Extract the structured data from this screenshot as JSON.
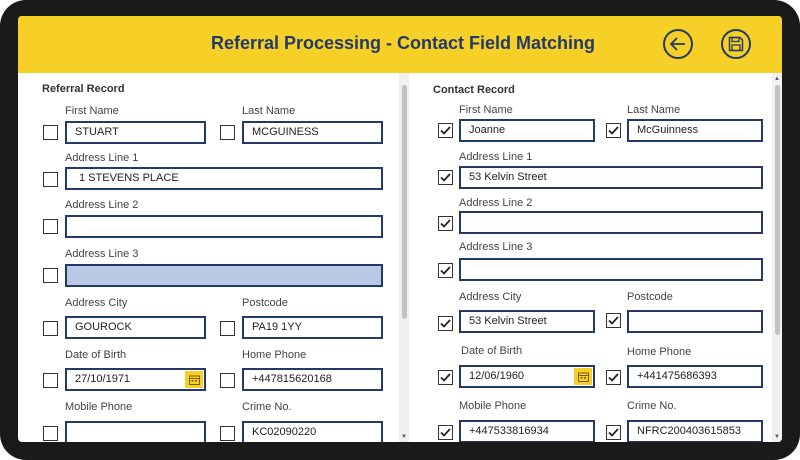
{
  "header": {
    "title": "Referral Processing - Contact Field Matching",
    "back_icon": "back-arrow-icon",
    "save_icon": "save-disk-icon",
    "accent": "#f6d027",
    "text_color": "#243a66"
  },
  "referral": {
    "title": "Referral Record",
    "first_name_label": "First Name",
    "first_name": "STUART",
    "last_name_label": "Last Name",
    "last_name": "MCGUINESS",
    "address1_label": "Address Line 1",
    "address1": "1 STEVENS PLACE",
    "address2_label": "Address Line 2",
    "address2": "",
    "address3_label": "Address Line 3",
    "address3": "",
    "city_label": "Address City",
    "city": "GOUROCK",
    "postcode_label": "Postcode",
    "postcode": "PA19 1YY",
    "dob_label": "Date of Birth",
    "dob": "27/10/1971",
    "home_phone_label": "Home Phone",
    "home_phone": "+447815620168",
    "mobile_label": "Mobile Phone",
    "mobile": "",
    "crime_label": "Crime No.",
    "crime": "KC02090220"
  },
  "contact": {
    "title": "Contact Record",
    "first_name_label": "First Name",
    "first_name": "Joanne",
    "last_name_label": "Last Name",
    "last_name": "McGuinness",
    "address1_label": "Address Line 1",
    "address1": "53 Kelvin Street",
    "address2_label": "Address Line 2",
    "address2": "",
    "address3_label": "Address Line 3",
    "address3": "",
    "city_label": "Address City",
    "city": "53 Kelvin Street",
    "postcode_label": "Postcode",
    "postcode": "",
    "dob_label": "Date of Birth",
    "dob": "12/06/1960",
    "home_phone_label": "Home Phone",
    "home_phone": "+441475686393",
    "mobile_label": "Mobile Phone",
    "mobile": "+447533816934",
    "crime_label": "Crime No.",
    "crime": "NFRC200403615853"
  }
}
